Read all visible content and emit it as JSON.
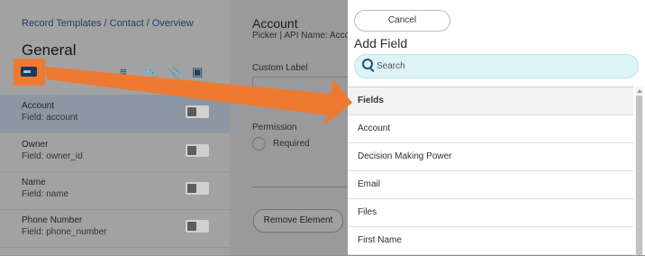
{
  "breadcrumb": {
    "part1": "Record Templates",
    "sep1": " / ",
    "part2": "Contact",
    "sep2": " / ",
    "part3": "Overview"
  },
  "section_title": "General",
  "rows": [
    {
      "title": "Account",
      "field": "Field: account"
    },
    {
      "title": "Owner",
      "field": "Field: owner_id"
    },
    {
      "title": "Name",
      "field": "Field: name"
    },
    {
      "title": "Phone Number",
      "field": "Field: phone_number"
    }
  ],
  "details": {
    "title": "Account",
    "subtitle": "Picker | API Name: Accou",
    "custom_label": "Custom Label",
    "permission": "Permission",
    "required": "Required",
    "remove_button": "Remove Element"
  },
  "add_field": {
    "cancel_label": "Cancel",
    "title": "Add Field",
    "search_placeholder": "Search",
    "items": [
      "Fields",
      "Account",
      "Decision Making Power",
      "Email",
      "Files",
      "First Name"
    ]
  },
  "colors": {
    "accent": "#ee7a32",
    "search_bg": "#dcf3f7",
    "icon": "#1a3a5c"
  }
}
